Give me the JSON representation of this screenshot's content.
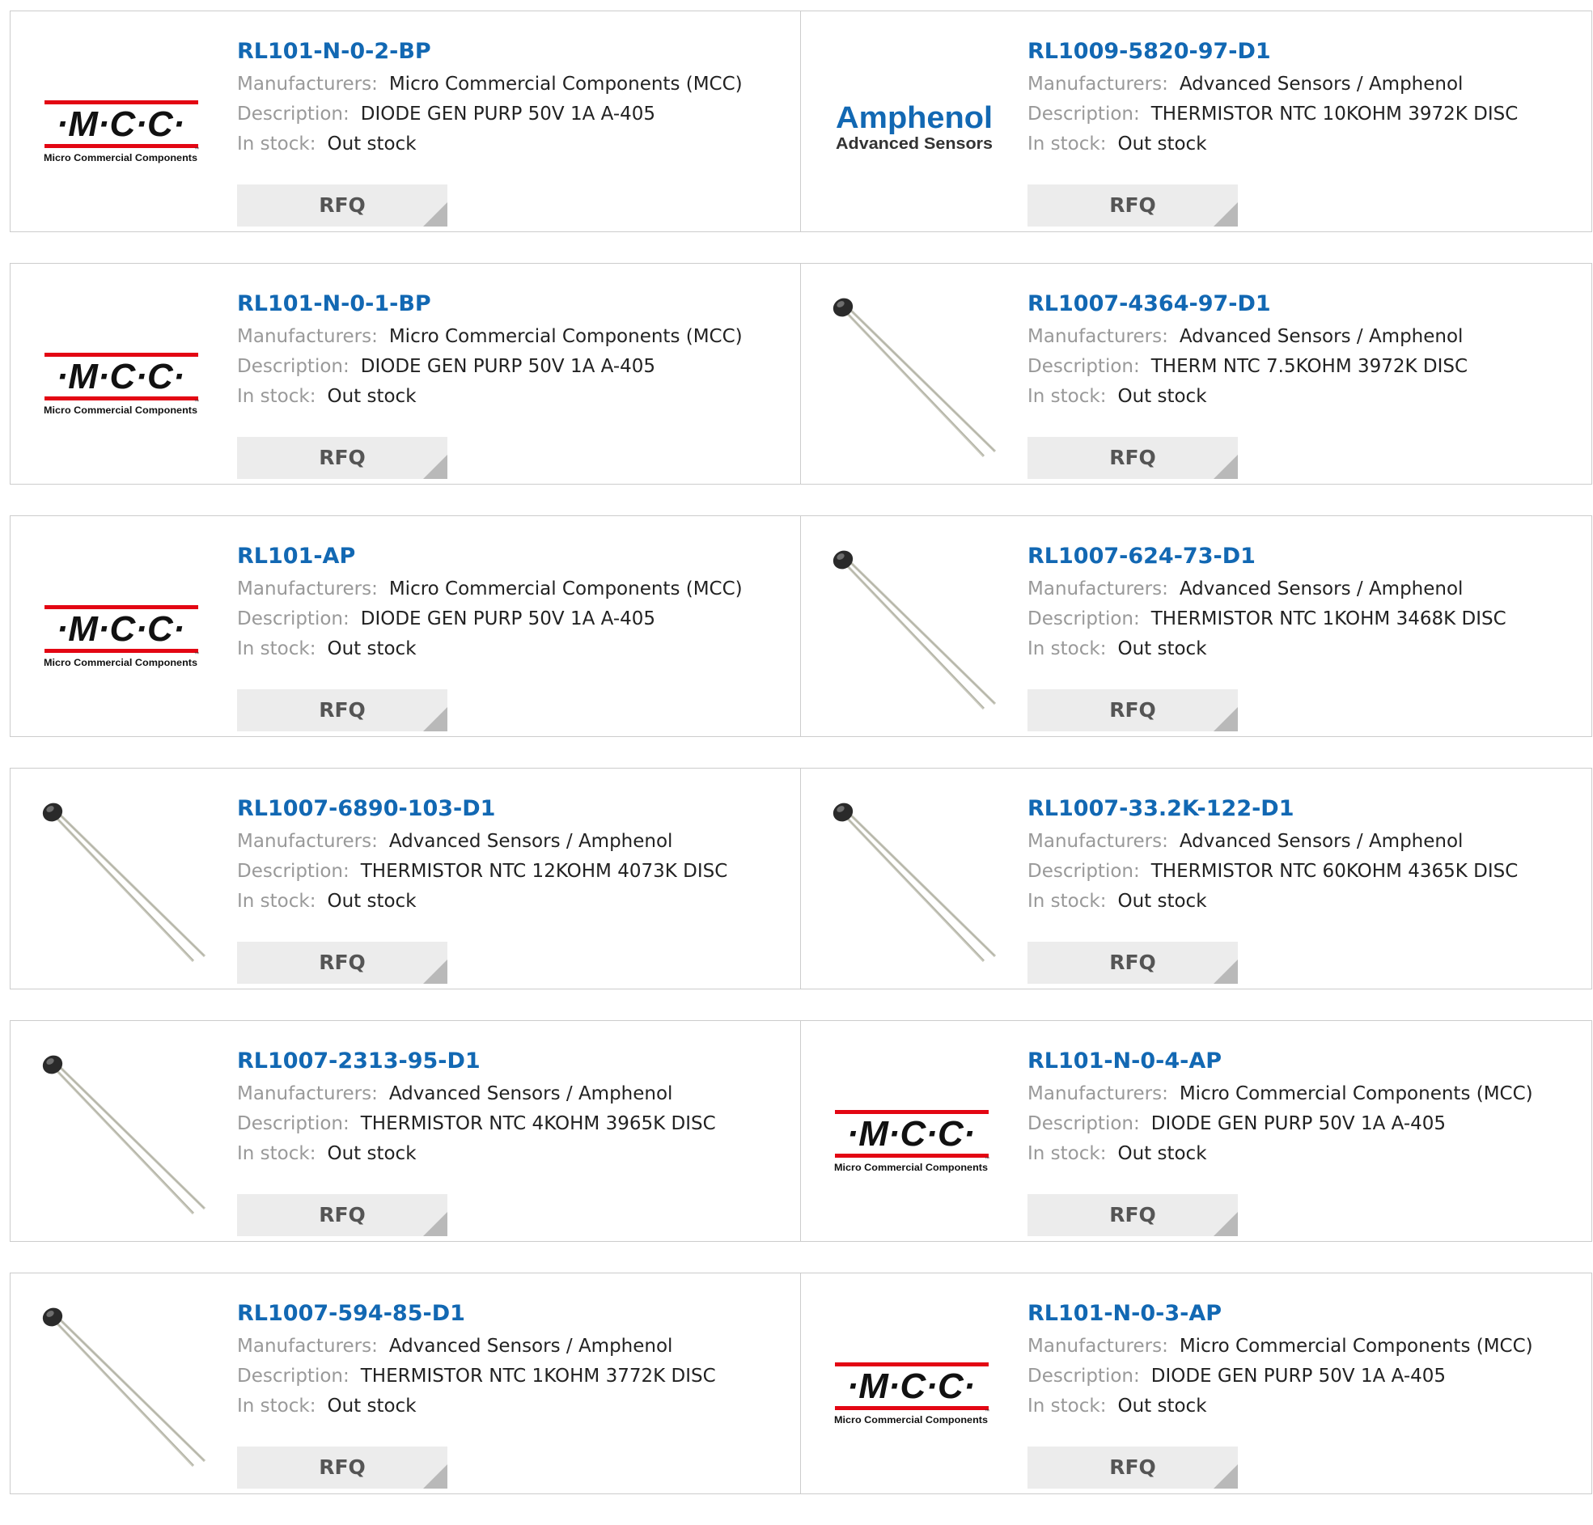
{
  "labels": {
    "manufacturers": "Manufacturers:",
    "description": "Description:",
    "in_stock": "In stock:",
    "rfq": "RFQ"
  },
  "logos": {
    "mcc": {
      "mark": "·M·C·C·",
      "tm": "™",
      "caption": "Micro Commercial Components",
      "bar_color": "#e30613",
      "text_color": "#111111"
    },
    "amphenol": {
      "brand": "Amphenol",
      "caption": "Advanced Sensors",
      "brand_color": "#1268b3"
    }
  },
  "colors": {
    "link": "#1268b3",
    "label": "#999999",
    "rfq_bg": "#ececec"
  },
  "products": [
    {
      "part": "RL101-N-0-2-BP",
      "manufacturer": "Micro Commercial Components (MCC)",
      "description": "DIODE GEN PURP 50V 1A A-405",
      "stock": "Out stock",
      "image": "mcc-logo"
    },
    {
      "part": "RL1009-5820-97-D1",
      "manufacturer": "Advanced Sensors / Amphenol",
      "description": "THERMISTOR NTC 10KOHM 3972K DISC",
      "stock": "Out stock",
      "image": "amphenol-logo"
    },
    {
      "part": "RL101-N-0-1-BP",
      "manufacturer": "Micro Commercial Components (MCC)",
      "description": "DIODE GEN PURP 50V 1A A-405",
      "stock": "Out stock",
      "image": "mcc-logo"
    },
    {
      "part": "RL1007-4364-97-D1",
      "manufacturer": "Advanced Sensors / Amphenol",
      "description": "THERM NTC 7.5KOHM 3972K DISC",
      "stock": "Out stock",
      "image": "thermistor-photo"
    },
    {
      "part": "RL101-AP",
      "manufacturer": "Micro Commercial Components (MCC)",
      "description": "DIODE GEN PURP 50V 1A A-405",
      "stock": "Out stock",
      "image": "mcc-logo"
    },
    {
      "part": "RL1007-624-73-D1",
      "manufacturer": "Advanced Sensors / Amphenol",
      "description": "THERMISTOR NTC 1KOHM 3468K DISC",
      "stock": "Out stock",
      "image": "thermistor-photo"
    },
    {
      "part": "RL1007-6890-103-D1",
      "manufacturer": "Advanced Sensors / Amphenol",
      "description": "THERMISTOR NTC 12KOHM 4073K DISC",
      "stock": "Out stock",
      "image": "thermistor-photo"
    },
    {
      "part": "RL1007-33.2K-122-D1",
      "manufacturer": "Advanced Sensors / Amphenol",
      "description": "THERMISTOR NTC 60KOHM 4365K DISC",
      "stock": "Out stock",
      "image": "thermistor-photo"
    },
    {
      "part": "RL1007-2313-95-D1",
      "manufacturer": "Advanced Sensors / Amphenol",
      "description": "THERMISTOR NTC 4KOHM 3965K DISC",
      "stock": "Out stock",
      "image": "thermistor-photo"
    },
    {
      "part": "RL101-N-0-4-AP",
      "manufacturer": "Micro Commercial Components (MCC)",
      "description": "DIODE GEN PURP 50V 1A A-405",
      "stock": "Out stock",
      "image": "mcc-logo"
    },
    {
      "part": "RL1007-594-85-D1",
      "manufacturer": "Advanced Sensors / Amphenol",
      "description": "THERMISTOR NTC 1KOHM 3772K DISC",
      "stock": "Out stock",
      "image": "thermistor-photo"
    },
    {
      "part": "RL101-N-0-3-AP",
      "manufacturer": "Micro Commercial Components (MCC)",
      "description": "DIODE GEN PURP 50V 1A A-405",
      "stock": "Out stock",
      "image": "mcc-logo"
    }
  ]
}
